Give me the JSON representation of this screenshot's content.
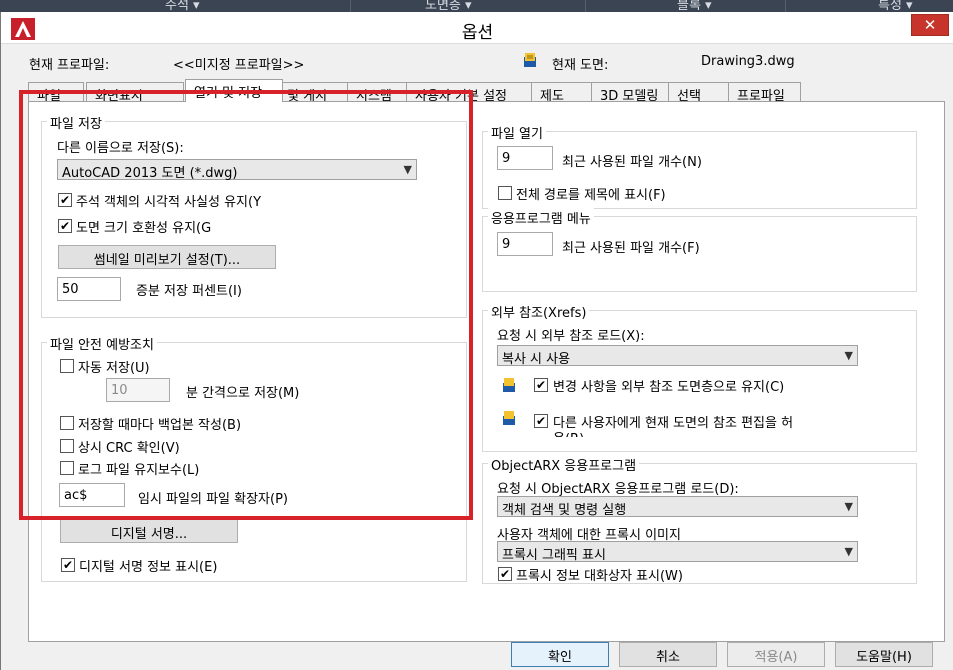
{
  "ribbon": {
    "items": [
      "주석",
      "도면층",
      "블록",
      "특성"
    ]
  },
  "dialog": {
    "title": "옵션",
    "close": "✕"
  },
  "header": {
    "profile_label": "현재 프로파일:",
    "profile_value": "<<미지정 프로파일>>",
    "drawing_label": "현재 도면:",
    "drawing_value": "Drawing3.dwg"
  },
  "tabs": [
    "파일",
    "화면표시",
    "열기 및 저장",
    "플롯 및 게시",
    "시스템",
    "사용자 기본 설정",
    "제도",
    "3D 모델링",
    "선택",
    "프로파일"
  ],
  "save": {
    "title": "파일 저장",
    "saveas_label": "다른 이름으로 저장(S):",
    "saveas_value": "AutoCAD 2013 도면 (*.dwg)",
    "annot_label": "주석 객체의 시각적 사실성 유지(Y",
    "compat_label": "도면 크기 호환성 유지(G",
    "thumb_btn": "썸네일 미리보기 설정(T)...",
    "incr_value": "50",
    "incr_label": "증분 저장 퍼센트(I)"
  },
  "safety": {
    "title": "파일 안전 예방조치",
    "autosave_label": "자동 저장(U)",
    "minutes_value": "10",
    "minutes_label": "분 간격으로 저장(M)",
    "backup_label": "저장할 때마다 백업본 작성(B)",
    "crc_label": "상시 CRC 확인(V)",
    "log_label": "로그 파일 유지보수(L)",
    "ext_value": "ac$",
    "ext_label": "임시 파일의 파일 확장자(P)",
    "digsig_btn": "디지털 서명...",
    "digsig_info_label": "디지털 서명 정보 표시(E)"
  },
  "open": {
    "title": "파일 열기",
    "recent_value": "9",
    "recent_label": "최근 사용된 파일 개수(N)",
    "fullpath_label": "전체 경로를 제목에 표시(F)"
  },
  "appmenu": {
    "title": "응용프로그램 메뉴",
    "recent_value": "9",
    "recent_label": "최근 사용된 파일 개수(F)"
  },
  "xrefs": {
    "title": "외부 참조(Xrefs)",
    "demand_label": "요청 시 외부 참조 로드(X):",
    "demand_value": "복사 시 사용",
    "retain_label": "변경 사항을 외부 참조 도면층으로 유지(C)",
    "allow_label": "다른 사용자에게 현재 도면의 참조 편집을 허",
    "allow_label2": "용(R)"
  },
  "arx": {
    "title": "ObjectARX 응용프로그램",
    "demand_label": "요청 시 ObjectARX 응용프로그램 로드(D):",
    "demand_value": "객체 검색 및 명령 실행",
    "proxy_label": "사용자 객체에 대한 프록시 이미지",
    "proxy_value": "프록시 그래픽 표시",
    "proxyinfo_label": "프록시 정보 대화상자 표시(W)"
  },
  "footer": {
    "ok": "확인",
    "cancel": "취소",
    "apply": "적용(A)",
    "help": "도움말(H)"
  },
  "colors": {
    "highlight": "#d8222a",
    "close": "#c7342b"
  }
}
